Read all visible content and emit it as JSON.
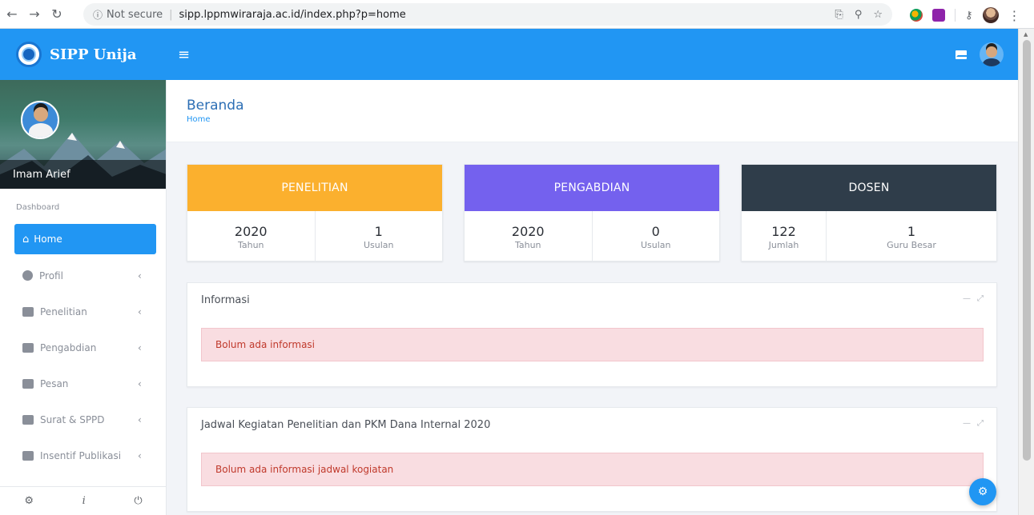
{
  "browser": {
    "security_label": "Not secure",
    "url": "sipp.lppmwiraraja.ac.id/index.php?p=home"
  },
  "app": {
    "brand": "SIPP Unija"
  },
  "user": {
    "name": "Imam Arief"
  },
  "sidebar": {
    "section_label": "Dashboard",
    "items": [
      {
        "label": "Home",
        "icon": "home-icon",
        "active": true
      },
      {
        "label": "Profil",
        "icon": "user-circle-icon"
      },
      {
        "label": "Penelitian",
        "icon": "document-icon"
      },
      {
        "label": "Pengabdian",
        "icon": "document-icon"
      },
      {
        "label": "Pesan",
        "icon": "envelope-icon"
      },
      {
        "label": "Surat & SPPD",
        "icon": "envelope-open-icon"
      },
      {
        "label": "Insentif Publikasi",
        "icon": "briefcase-icon"
      }
    ]
  },
  "page": {
    "title": "Beranda",
    "breadcrumb": "Home"
  },
  "cards": [
    {
      "title": "PENELITIAN",
      "color": "#fbb02e",
      "stats": [
        {
          "value": "2020",
          "label": "Tahun"
        },
        {
          "value": "1",
          "label": "Usulan"
        }
      ]
    },
    {
      "title": "PENGABDIAN",
      "color": "#7461ee",
      "stats": [
        {
          "value": "2020",
          "label": "Tahun"
        },
        {
          "value": "0",
          "label": "Usulan"
        }
      ]
    },
    {
      "title": "DOSEN",
      "color": "#2f3d4a",
      "stats": [
        {
          "value": "122",
          "label": "Jumlah"
        },
        {
          "value": "1",
          "label": "Guru Besar"
        }
      ]
    }
  ],
  "panels": [
    {
      "title": "Informasi",
      "message": "Bolum ada informasi"
    },
    {
      "title": "Jadwal Kegiatan Penelitian dan PKM Dana Internal 2020",
      "message": "Bolum ada informasi jadwal kogiatan"
    }
  ],
  "colors": {
    "primary": "#2196f3",
    "alert_bg": "#f9dde1",
    "alert_text": "#c0392b"
  }
}
